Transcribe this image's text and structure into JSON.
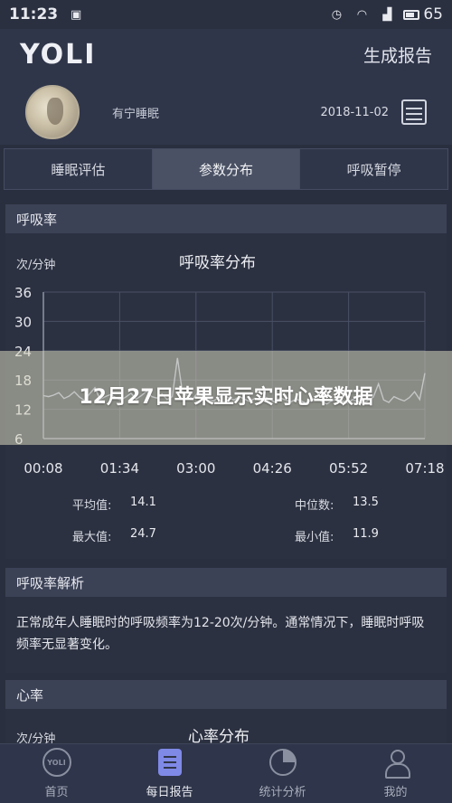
{
  "status_bar": {
    "time": "11:23",
    "battery": "65"
  },
  "header": {
    "logo": "YOLI",
    "action": "生成报告"
  },
  "profile": {
    "name": "有宁睡眠",
    "date": "2018-11-02"
  },
  "tabs": [
    {
      "label": "睡眠评估",
      "active": false
    },
    {
      "label": "参数分布",
      "active": true
    },
    {
      "label": "呼吸暂停",
      "active": false
    }
  ],
  "respiration": {
    "section_title": "呼吸率",
    "chart_title": "呼吸率分布",
    "unit": "次/分钟"
  },
  "chart_data": {
    "type": "line",
    "title": "呼吸率分布",
    "ylabel": "次/分钟",
    "xlabel": "",
    "ylim": [
      6,
      36
    ],
    "y_ticks": [
      "36",
      "30",
      "24",
      "18",
      "12",
      "6"
    ],
    "x_ticks": [
      "00:08",
      "01:34",
      "03:00",
      "04:26",
      "05:52",
      "07:18"
    ],
    "grid": true,
    "series": [
      {
        "values": [
          14.8,
          14.6,
          14.9,
          15.4,
          14.2,
          14.7,
          15.6,
          14.5,
          13.8,
          15.2,
          16.4,
          14.0,
          14.6,
          15.0,
          14.4,
          13.9,
          14.5,
          15.3,
          14.1,
          14.8,
          15.7,
          14.6,
          14.3,
          15.1,
          14.0,
          14.6,
          22.5,
          15.2,
          14.8,
          14.1,
          15.5,
          14.6,
          14.2,
          13.7,
          14.4,
          15.0,
          14.3,
          13.9,
          14.6,
          14.1,
          13.6,
          14.2,
          13.8,
          14.5,
          14.0,
          13.4,
          14.3,
          13.9,
          13.5,
          14.1,
          13.7,
          13.2,
          13.9,
          14.4,
          13.6,
          13.1,
          13.8,
          14.2,
          13.7,
          13.3,
          14.0,
          13.6,
          13.2,
          13.8,
          14.5,
          17.2,
          13.9,
          13.4,
          14.6,
          14.1,
          13.7,
          14.4,
          15.6,
          14.0,
          19.4
        ]
      }
    ]
  },
  "stats": {
    "avg_label": "平均值:",
    "avg_value": "14.1",
    "median_label": "中位数:",
    "median_value": "13.5",
    "max_label": "最大值:",
    "max_value": "24.7",
    "min_label": "最小值:",
    "min_value": "11.9"
  },
  "analysis": {
    "section_title": "呼吸率解析",
    "text": "正常成年人睡眠时的呼吸频率为12-20次/分钟。通常情况下，睡眠时呼吸频率无显著变化。"
  },
  "heart": {
    "section_title": "心率",
    "chart_title": "心率分布",
    "unit": "次/分钟"
  },
  "overlay": {
    "text": "12月27日苹果显示实时心率数据"
  },
  "bottom_nav": [
    {
      "label": "首页",
      "icon": "home-icon",
      "active": false
    },
    {
      "label": "每日报告",
      "icon": "report-icon",
      "active": true
    },
    {
      "label": "统计分析",
      "icon": "stats-icon",
      "active": false
    },
    {
      "label": "我的",
      "icon": "user-icon",
      "active": false
    }
  ],
  "colors": {
    "background": "#2a2f3f",
    "accent": "#7f89e6",
    "line": "#aab3cf"
  }
}
